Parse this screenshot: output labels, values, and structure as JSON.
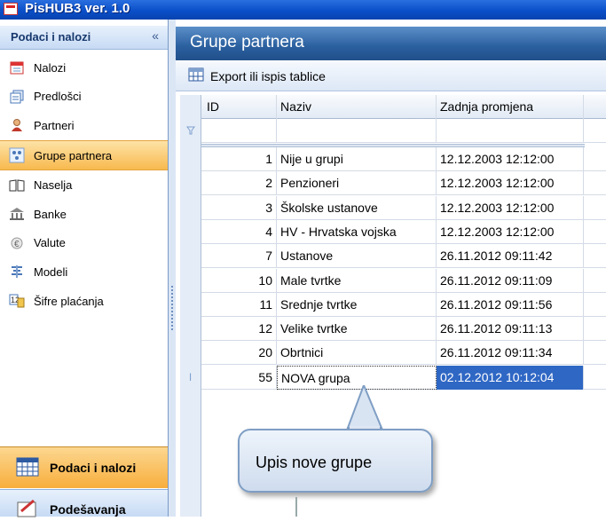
{
  "window": {
    "title": "PisHUB3 ver. 1.0"
  },
  "nav": {
    "header": "Podaci i nalozi",
    "collapse_icon": "«",
    "items": [
      {
        "label": "Nalozi",
        "icon": "calendar-icon"
      },
      {
        "label": "Predlošci",
        "icon": "templates-icon"
      },
      {
        "label": "Partneri",
        "icon": "person-icon"
      },
      {
        "label": "Grupe partnera",
        "icon": "group-icon",
        "active": true
      },
      {
        "label": "Naselja",
        "icon": "book-icon"
      },
      {
        "label": "Banke",
        "icon": "bank-icon"
      },
      {
        "label": "Valute",
        "icon": "currency-icon"
      },
      {
        "label": "Modeli",
        "icon": "models-icon"
      },
      {
        "label": "Šifre plaćanja",
        "icon": "payment-codes-icon"
      }
    ],
    "bottom": {
      "primary": "Podaci i nalozi",
      "secondary": "Podešavanja"
    }
  },
  "main": {
    "title": "Grupe partnera",
    "toolbar": {
      "export_label": "Export ili ispis tablice"
    },
    "grid": {
      "columns": [
        "ID",
        "Naziv",
        "Zadnja promjena"
      ],
      "rows": [
        {
          "id": "1",
          "naziv": "Nije u grupi",
          "datum": "12.12.2003 12:12:00"
        },
        {
          "id": "2",
          "naziv": "Penzioneri",
          "datum": "12.12.2003 12:12:00"
        },
        {
          "id": "3",
          "naziv": "Školske ustanove",
          "datum": "12.12.2003 12:12:00"
        },
        {
          "id": "4",
          "naziv": "HV - Hrvatska vojska",
          "datum": "12.12.2003 12:12:00"
        },
        {
          "id": "7",
          "naziv": "Ustanove",
          "datum": "26.11.2012 09:11:42"
        },
        {
          "id": "10",
          "naziv": "Male tvrtke",
          "datum": "26.11.2012 09:11:09"
        },
        {
          "id": "11",
          "naziv": "Srednje tvrtke",
          "datum": "26.11.2012 09:11:56"
        },
        {
          "id": "12",
          "naziv": "Velike tvrtke",
          "datum": "26.11.2012 09:11:13"
        },
        {
          "id": "20",
          "naziv": "Obrtnici",
          "datum": "26.11.2012 09:11:34"
        },
        {
          "id": "55",
          "naziv": "NOVA grupa",
          "datum": "02.12.2012 10:12:04",
          "selected": true
        }
      ],
      "edit_marker": "I"
    }
  },
  "callout": {
    "text": "Upis nove grupe"
  },
  "colors": {
    "accent": "#2a5f9e",
    "active_nav": "#f8b94e",
    "selection": "#2f67c4",
    "titlebar": "#0a4fc8"
  }
}
